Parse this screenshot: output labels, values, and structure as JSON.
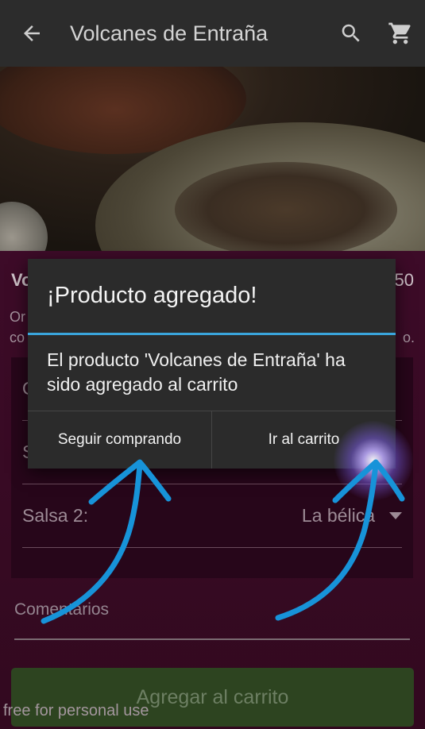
{
  "appbar": {
    "title": "Volcanes de Entraña",
    "back_icon": "arrow-back-icon",
    "search_icon": "search-icon",
    "cart_icon": "shopping-cart-icon"
  },
  "social": [
    "facebook-icon",
    "instagram-icon",
    "twitter-icon",
    "whatsapp-icon"
  ],
  "product": {
    "name_visible": "Vo",
    "price_visible": "50",
    "desc_line1_visible": "Or",
    "desc_line2_visible": "co",
    "desc_line2_end_visible": "o."
  },
  "form": {
    "field1_visible": "O",
    "field2_visible": "S",
    "salsa2_label": "Salsa 2:",
    "salsa2_value": "La bélica",
    "comments_placeholder": "Comentarios",
    "add_button": "Agregar al carrito"
  },
  "dialog": {
    "title": "¡Producto agregado!",
    "message": "El producto 'Volcanes de Entraña' ha sido agregado al carrito",
    "btn_continue": "Seguir comprando",
    "btn_cart": "Ir al carrito"
  },
  "watermark": "free for personal use",
  "colors": {
    "accent": "#3aa5dc",
    "appbar": "#2c2c2c",
    "dialog_bg": "#2b2b2b",
    "content_bg": "#3d0b28",
    "add_button_bg": "#2d4420",
    "arrow": "#1793d9"
  }
}
